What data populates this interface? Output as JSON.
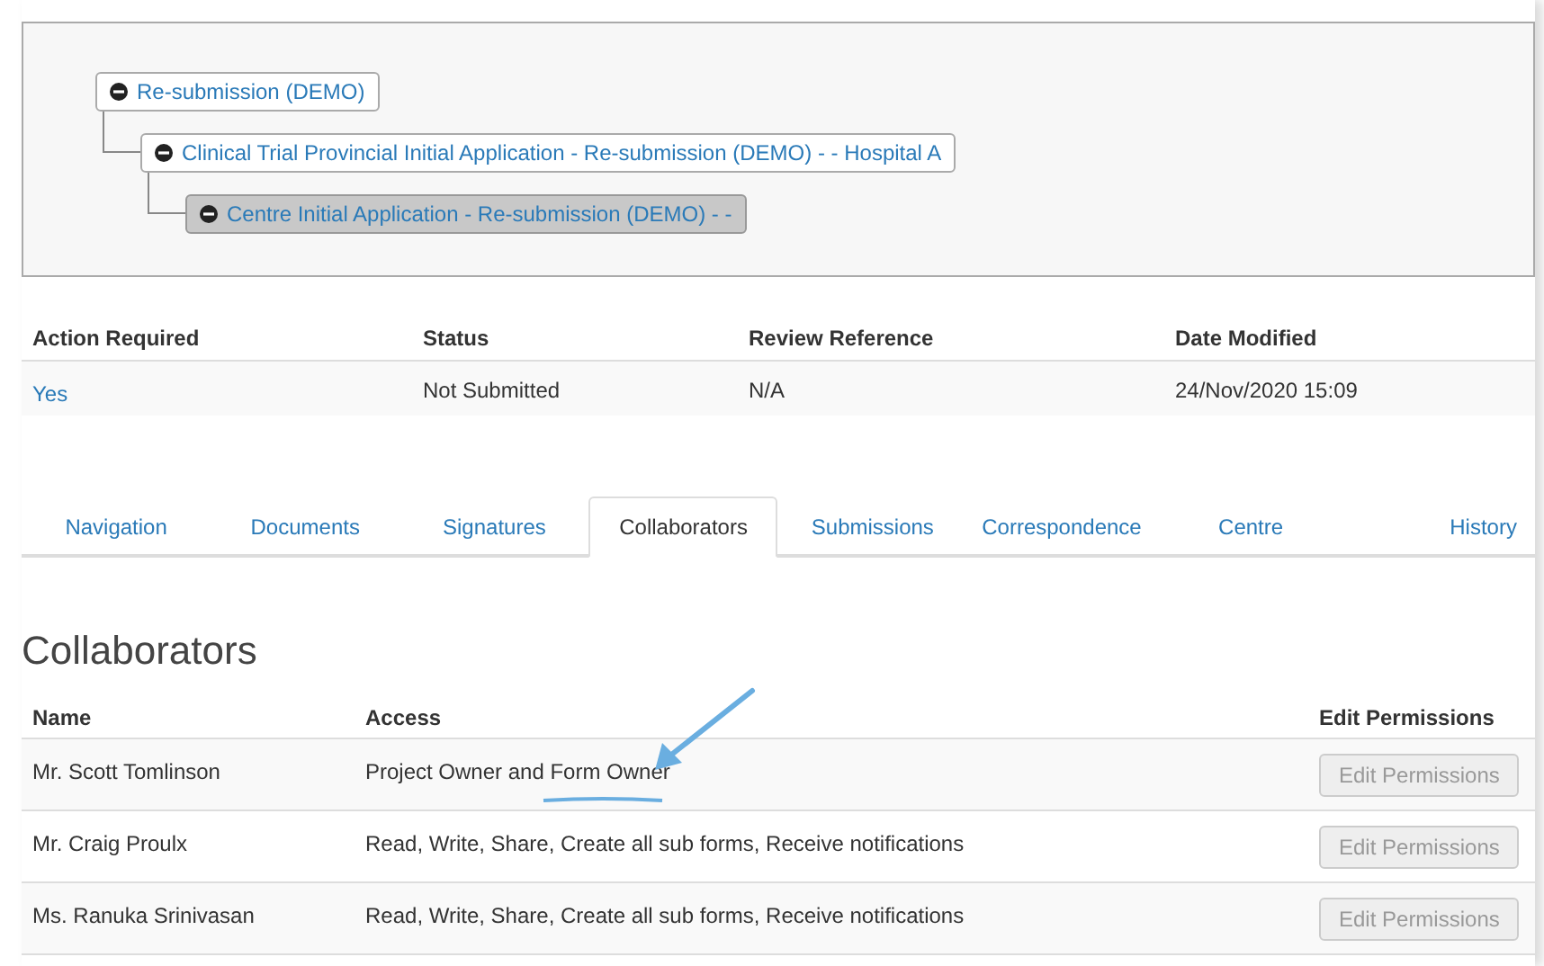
{
  "tree": {
    "label": "Re-submission (DEMO)",
    "selected": false,
    "children": [
      {
        "label": "Clinical Trial Provincial Initial Application - Re-submission (DEMO) - - Hospital A",
        "selected": false,
        "children": [
          {
            "label": "Centre Initial Application - Re-submission (DEMO) - -",
            "selected": true
          }
        ]
      }
    ]
  },
  "summary": {
    "columns": [
      "Action Required",
      "Status",
      "Review Reference",
      "Date Modified"
    ],
    "row": [
      {
        "text": "Yes",
        "kind": "link"
      },
      {
        "text": "Not Submitted",
        "kind": "text"
      },
      {
        "text": "N/A",
        "kind": "text"
      },
      {
        "text": "24/Nov/2020 15:09",
        "kind": "text"
      }
    ]
  },
  "tabs": [
    {
      "label": "Navigation",
      "selected": false
    },
    {
      "label": "Documents",
      "selected": false
    },
    {
      "label": "Signatures",
      "selected": false
    },
    {
      "label": "Collaborators",
      "selected": true
    },
    {
      "label": "Submissions",
      "selected": false
    },
    {
      "label": "Correspondence",
      "selected": false
    },
    {
      "label": "Centre",
      "selected": false
    },
    {
      "label": "History",
      "selected": false
    }
  ],
  "collaborators": {
    "title": "Collaborators",
    "columns": [
      "Name",
      "Access",
      "Edit Permissions"
    ],
    "rows": [
      {
        "name": "Mr. Scott Tomlinson",
        "access": "Project Owner and Form Owner",
        "button": "Edit Permissions",
        "disabled": true
      },
      {
        "name": "Mr. Craig Proulx",
        "access": "Read, Write, Share, Create all sub forms, Receive notifications",
        "button": "Edit Permissions",
        "disabled": true
      },
      {
        "name": "Ms. Ranuka Srinivasan",
        "access": "Read, Write, Share, Create all sub forms, Receive notifications",
        "button": "Edit Permissions",
        "disabled": true
      }
    ]
  }
}
